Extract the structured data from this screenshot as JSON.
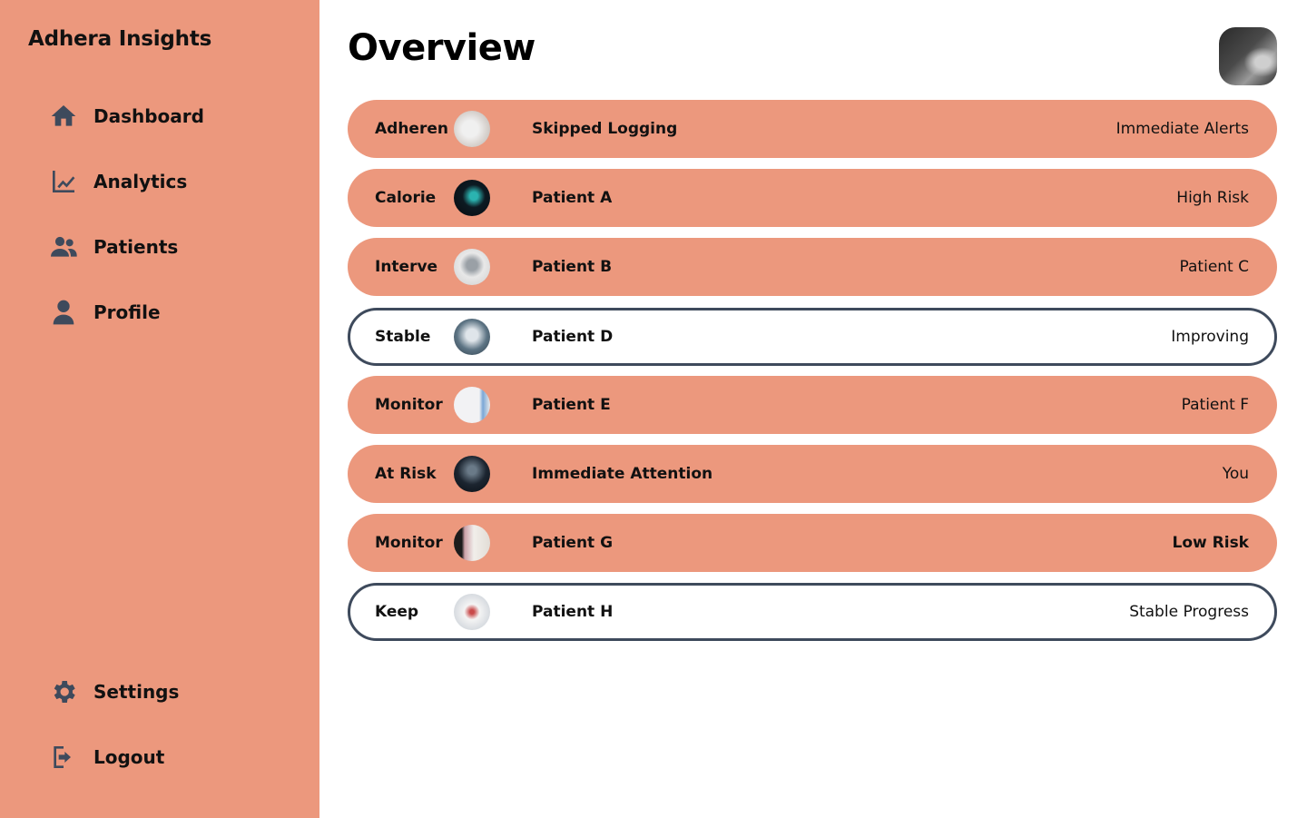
{
  "app": {
    "brand": "Adhera Insights"
  },
  "sidebar": {
    "items": [
      {
        "label": "Dashboard",
        "icon": "home-icon"
      },
      {
        "label": "Analytics",
        "icon": "chart-line-icon"
      },
      {
        "label": "Patients",
        "icon": "users-icon"
      },
      {
        "label": "Profile",
        "icon": "user-icon"
      }
    ],
    "bottom_items": [
      {
        "label": "Settings",
        "icon": "gear-icon"
      },
      {
        "label": "Logout",
        "icon": "logout-icon"
      }
    ]
  },
  "main": {
    "title": "Overview",
    "rows": [
      {
        "tag": "Adheren",
        "name": "Skipped Logging",
        "status": "Immediate Alerts",
        "style": "filled"
      },
      {
        "tag": "Calorie",
        "name": "Patient A",
        "status": "High Risk",
        "style": "filled"
      },
      {
        "tag": "Interve",
        "name": "Patient B",
        "status": "Patient C",
        "style": "filled"
      },
      {
        "tag": "Stable",
        "name": "Patient D",
        "status": "Improving",
        "style": "outline"
      },
      {
        "tag": "Monitor",
        "name": "Patient E",
        "status": "Patient F",
        "style": "filled"
      },
      {
        "tag": "At Risk",
        "name": "Immediate Attention",
        "status": "You",
        "style": "filled"
      },
      {
        "tag": "Monitor",
        "name": "Patient G",
        "status": "Low Risk",
        "style": "filled"
      },
      {
        "tag": "Keep",
        "name": "Patient H",
        "status": "Stable Progress",
        "style": "outline"
      }
    ]
  },
  "colors": {
    "sidebar_bg": "#EC987D",
    "row_fill": "#EC987D",
    "row_outline": "#3E4A5C",
    "icon": "#3E4A5C"
  }
}
